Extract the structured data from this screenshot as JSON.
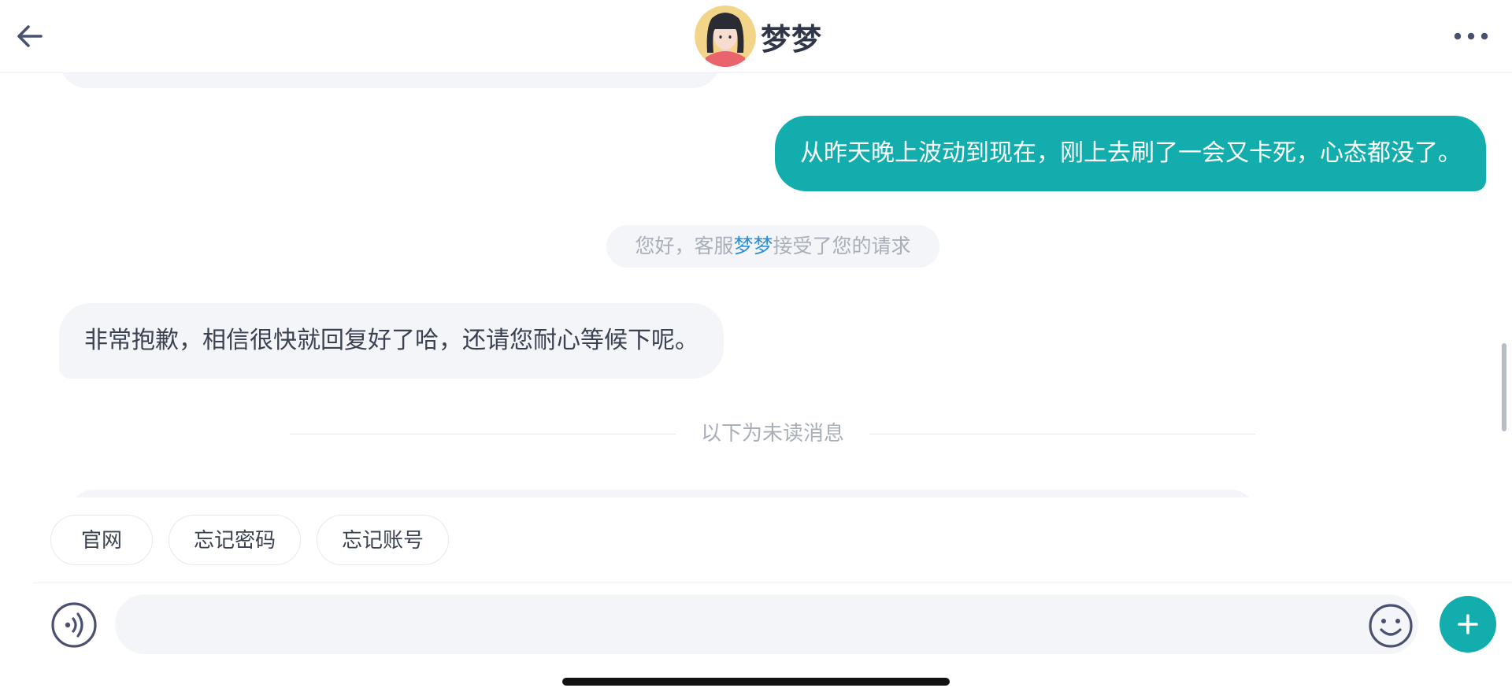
{
  "header": {
    "back_icon": "arrow-left-icon",
    "title": "梦梦",
    "more_icon": "more-dots-icon"
  },
  "messages": {
    "outgoing": "从昨天晚上波动到现在，刚上去刷了一会又卡死，心态都没了。",
    "system_prefix": "您好，客服",
    "system_agent": "梦梦",
    "system_suffix": "接受了您的请求",
    "incoming": "非常抱歉，相信很快就回复好了哈，还请您耐心等候下呢。",
    "unread_divider": "以下为未读消息"
  },
  "quick_replies": [
    "官网",
    "忘记密码",
    "忘记账号"
  ],
  "input": {
    "value": "",
    "voice_icon": "voice-icon",
    "emoji_icon": "emoji-icon",
    "plus_icon": "plus-icon"
  },
  "colors": {
    "accent": "#14adad",
    "bubble_bg": "#f3f5f8",
    "agent_highlight": "#2f8fd6",
    "text": "#3a4150",
    "muted": "#a9afb9"
  }
}
